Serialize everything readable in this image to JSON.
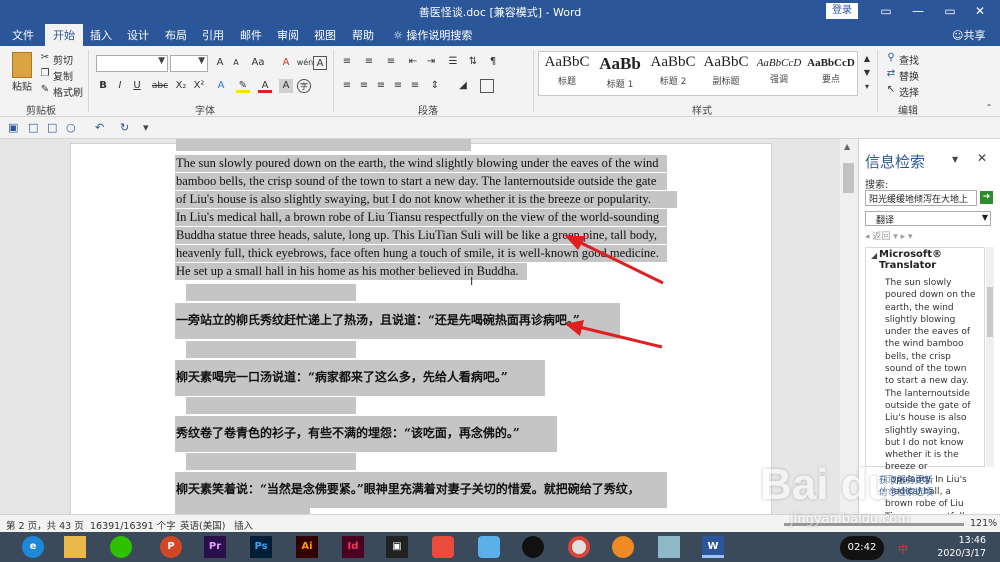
{
  "titlebar": {
    "title": "善医怪谈.doc [兼容模式] - Word",
    "login": "登录",
    "min": "—",
    "restore": "▭",
    "close": "✕",
    "ribbon_display": "▭"
  },
  "tabs": {
    "file": "文件",
    "home": "开始",
    "insert": "插入",
    "design": "设计",
    "layout": "布局",
    "references": "引用",
    "mailings": "邮件",
    "review": "审阅",
    "view": "视图",
    "help": "帮助",
    "tell_me": "操作说明搜索",
    "share": "共享"
  },
  "clipboard": {
    "paste": "粘贴",
    "cut": "剪切",
    "copy": "复制",
    "format_painter": "格式刷",
    "group": "剪贴板"
  },
  "font": {
    "group": "字体",
    "font_name": "",
    "font_size": "",
    "bold": "B",
    "italic": "I",
    "underline": "U",
    "strike": "abc",
    "sub": "X₂",
    "sup": "X²",
    "font_color": "A",
    "grow": "A",
    "shrink": "A",
    "case": "Aa",
    "clear": "A",
    "phonetic": "wén",
    "border_char": "A"
  },
  "paragraph": {
    "group": "段落"
  },
  "styles": {
    "group": "样式",
    "items": [
      {
        "sample": "AaBbC",
        "label": "标题"
      },
      {
        "sample": "AaBb",
        "label": "标题 1"
      },
      {
        "sample": "AaBbC",
        "label": "标题 2"
      },
      {
        "sample": "AaBbC",
        "label": "副标题"
      },
      {
        "sample": "AaBbCcD",
        "label": "强调"
      },
      {
        "sample": "AaBbCcD",
        "label": "要点"
      }
    ]
  },
  "editing": {
    "group": "编辑",
    "find": "查找",
    "replace": "替换",
    "select": "选择"
  },
  "document": {
    "english_lines": [
      "The sun slowly poured down on the earth, the wind slightly blowing under the eaves of the wind",
      "bamboo bells, the crisp sound of the town to start a new day.   The lanternoutside outside the gate",
      "of Liu's house is also slightly swaying, but I do not know whether it is the breeze or popularity.",
      "In Liu's medical hall, a brown robe of Liu Tiansu respectfully on the view of the world-sounding",
      "Buddha statue three heads, salute, long up.   This LiuTian Suli will be like a green pine, tall body,",
      "heavenly full, thick eyebrows, face often hung a touch of smile, it is well-known good medicine.",
      "He set up a small hall in his home as his mother believed in Buddha."
    ],
    "chinese_lines": [
      "一旁站立的柳氏秀纹赶忙递上了热汤，且说道：“还是先喝碗热面再诊病吧。”",
      "柳天素喝完一口汤说道：“病家都来了这么多，先给人看病吧。”",
      "秀纹卷了卷青色的衫子，有些不满的埋怨：“该吃面，再念佛的。”",
      "柳天素笑着说：“当然是念佛要紧。”眼神里充满着对妻子关切的惜爱。就把碗给了秀纹，"
    ]
  },
  "pane": {
    "title": "信息检索",
    "search_label": "搜索:",
    "search_value": "阳光缓缓地倾泻在大地上",
    "service": "翻译",
    "nav": "◂ 返回  ▾  ▸  ▾",
    "provider": "Microsoft® Translator",
    "translation": "The sun slowly poured down on the earth, the wind slightly blowing under the eaves of the wind bamboo bells, the crisp sound of the town to start a new day. The lanternoutside outside the gate of Liu's house is also slightly swaying, but I do not know whether it is the breeze or popularity. In Liu's medical hall, a brown robe of Liu Tiansu respectfully on the view",
    "link1": "获取服务更新",
    "link2": "信息检索选项"
  },
  "status": {
    "page": "第 2 页，共 43 页",
    "words": "16391/16391 个字",
    "lang": "英语(美国)",
    "mode": "插入",
    "zoom": "121%"
  },
  "taskbar": {
    "clock_time": "13:46",
    "clock_date": "2020/3/17",
    "timer": "02:42",
    "ime": "中"
  },
  "watermark": {
    "brand": "Bai du",
    "sub": "jingyan.baidu.com"
  },
  "colors": {
    "accent": "#2b579a",
    "highlight": "#c5c5c5",
    "arrow": "#e02020"
  }
}
